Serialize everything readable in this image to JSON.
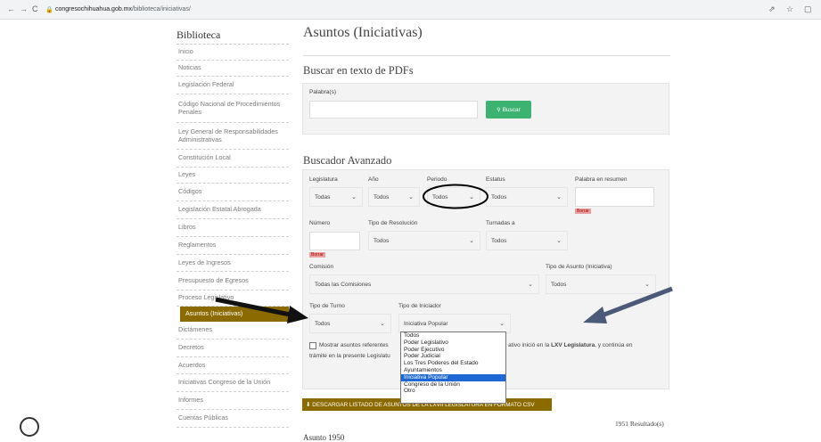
{
  "browser": {
    "url_domain": "congresochihuahua.gob.mx",
    "url_path": "/biblioteca/iniciativas/"
  },
  "sidebar": {
    "title": "Biblioteca",
    "items": [
      {
        "label": "Inicio",
        "h": 18
      },
      {
        "label": "Noticias",
        "h": 18
      },
      {
        "label": "Legislación Federal",
        "h": 20
      },
      {
        "label": "Código Nacional de Procedimientos Penales",
        "h": 32
      },
      {
        "label": "Ley General de Responsabilidades Administrativas",
        "h": 30
      },
      {
        "label": "Constitución Local",
        "h": 20
      },
      {
        "label": "Leyes",
        "h": 18
      },
      {
        "label": "Códigos",
        "h": 20
      },
      {
        "label": "Legislación Estatal Abrogada",
        "h": 20
      },
      {
        "label": "Libros",
        "h": 20
      },
      {
        "label": "Reglamentos",
        "h": 20
      },
      {
        "label": "Leyes de Ingresos",
        "h": 19
      },
      {
        "label": "Presupuesto de Egresos",
        "h": 21
      },
      {
        "label": "Proceso Legislativo",
        "h": 18
      },
      {
        "label": "Asuntos (Iniciativas)",
        "h": 17
      },
      {
        "label": "Dictámenes",
        "h": 20
      },
      {
        "label": "Decretos",
        "h": 20
      },
      {
        "label": "Acuerdos",
        "h": 19
      },
      {
        "label": "Iniciativas Congreso de la Unión",
        "h": 20
      },
      {
        "label": "Informes",
        "h": 20
      },
      {
        "label": "Cuentas Públicas",
        "h": 20
      }
    ]
  },
  "main": {
    "title": "Asuntos (Iniciativas)",
    "pdf_search": {
      "heading": "Buscar en texto de PDFs",
      "field_label": "Palabra(s)",
      "value": "",
      "button": "Buscar"
    },
    "advanced": {
      "heading": "Buscador Avanzado",
      "legislatura": {
        "label": "Legislatura",
        "value": "Todas"
      },
      "anio": {
        "label": "Año",
        "value": "Todos"
      },
      "periodo": {
        "label": "Periodo",
        "value": "Todos"
      },
      "estatus": {
        "label": "Estatus",
        "value": "Todos"
      },
      "palabra_resumen": {
        "label": "Palabra en resumen",
        "value": "",
        "clear": "Borrar"
      },
      "numero": {
        "label": "Número",
        "value": "",
        "clear": "Borrar"
      },
      "tipo_resolucion": {
        "label": "Tipo de Resolución",
        "value": "Todos"
      },
      "turnadas": {
        "label": "Turnadas a",
        "value": "Todos"
      },
      "comision": {
        "label": "Comisión",
        "value": "Todas las Comisiones"
      },
      "tipo_asunto": {
        "label": "Tipo de Asunto (Iniciativa)",
        "value": "Todos"
      },
      "tipo_turno": {
        "label": "Tipo de Turno",
        "value": "Todos"
      },
      "tipo_iniciador": {
        "label": "Tipo de Iniciador",
        "value": "Iniciativa Popular",
        "options": [
          "Todos",
          "Poder Legislativo",
          "Poder Ejecutivo",
          "Poder Judicial",
          "Los Tres Poderes del Estado",
          "Ayuntamientos",
          "Iniciativa Popular",
          "Congreso de la Unión",
          "Otro"
        ],
        "selected_index": 6
      },
      "checkbox_text_a": "Mostrar asuntos referentes",
      "checkbox_text_b": "ativo inició en la",
      "checkbox_text_bold": "LXV Legislatura",
      "checkbox_text_c": ", y continúa en",
      "checkbox_text_d": "trámite en la presente Legislatu"
    },
    "download_button": "DESCARGAR LISTADO DE ASUNTOS DE LA LXVII LEGISLATURA EN FORMATO CSV",
    "results": "1951 Resultado(s)",
    "first_result": "Asunto 1950"
  },
  "colors": {
    "accent": "#8b6b00",
    "button_green": "#3cb371",
    "highlight_blue": "#1e68d6"
  }
}
